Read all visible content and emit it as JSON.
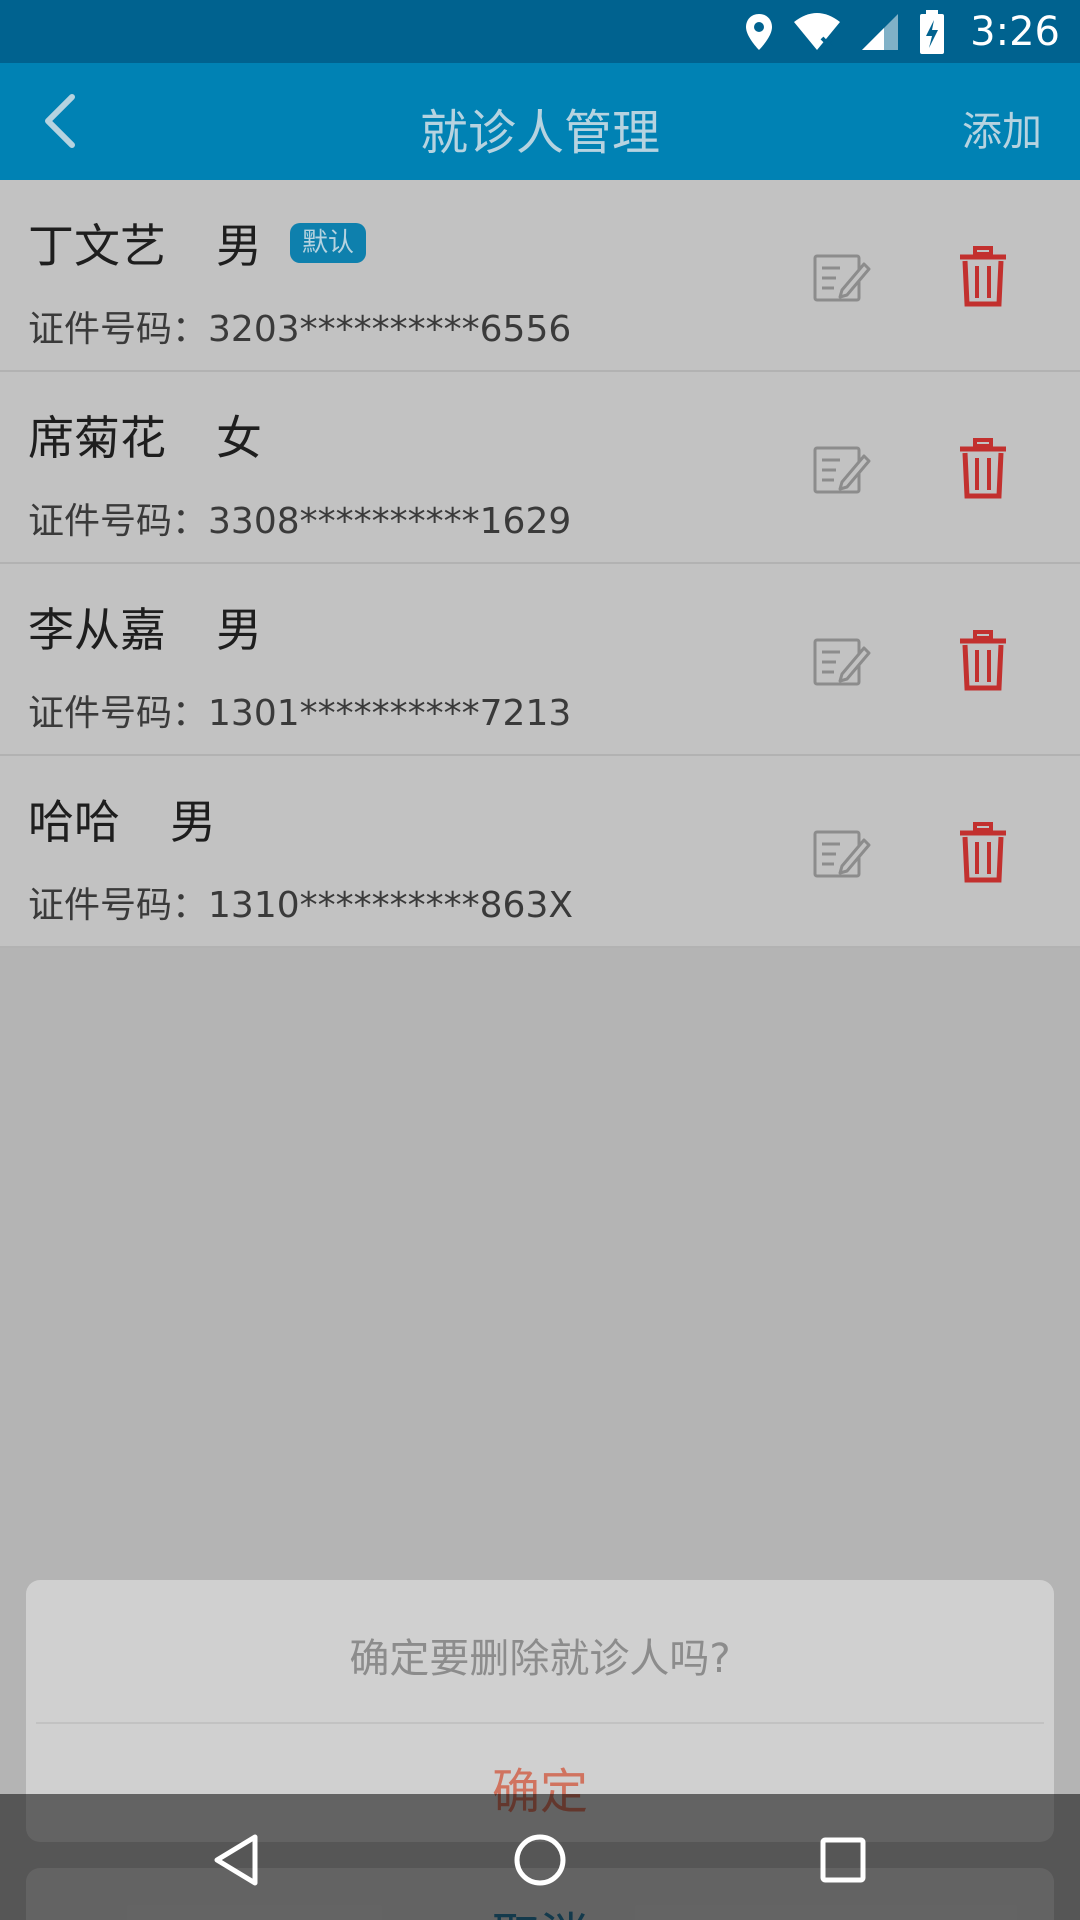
{
  "status_bar": {
    "time": "3:26",
    "icons": [
      "location-icon",
      "wifi-icon",
      "signal-icon",
      "battery-charging-icon"
    ]
  },
  "header": {
    "title": "就诊人管理",
    "add_label": "添加",
    "back_icon": "chevron-left-icon"
  },
  "patients": [
    {
      "name": "丁文艺",
      "gender": "男",
      "default_badge": "默认",
      "id_label": "证件号码：",
      "id_number": "3203**********6556"
    },
    {
      "name": "席菊花",
      "gender": "女",
      "id_label": "证件号码：",
      "id_number": "3308**********1629"
    },
    {
      "name": "李从嘉",
      "gender": "男",
      "id_label": "证件号码：",
      "id_number": "1301**********7213"
    },
    {
      "name": "哈哈",
      "gender": "男",
      "id_label": "证件号码：",
      "id_number": "1310**********863X"
    }
  ],
  "dialog": {
    "message": "确定要删除就诊人吗?",
    "confirm_label": "确定",
    "cancel_label": "取消"
  },
  "colors": {
    "header_bg": "#0082b4",
    "status_bg": "#00628f",
    "delete_red": "#c2302e",
    "badge_bg": "#0e80ad"
  }
}
